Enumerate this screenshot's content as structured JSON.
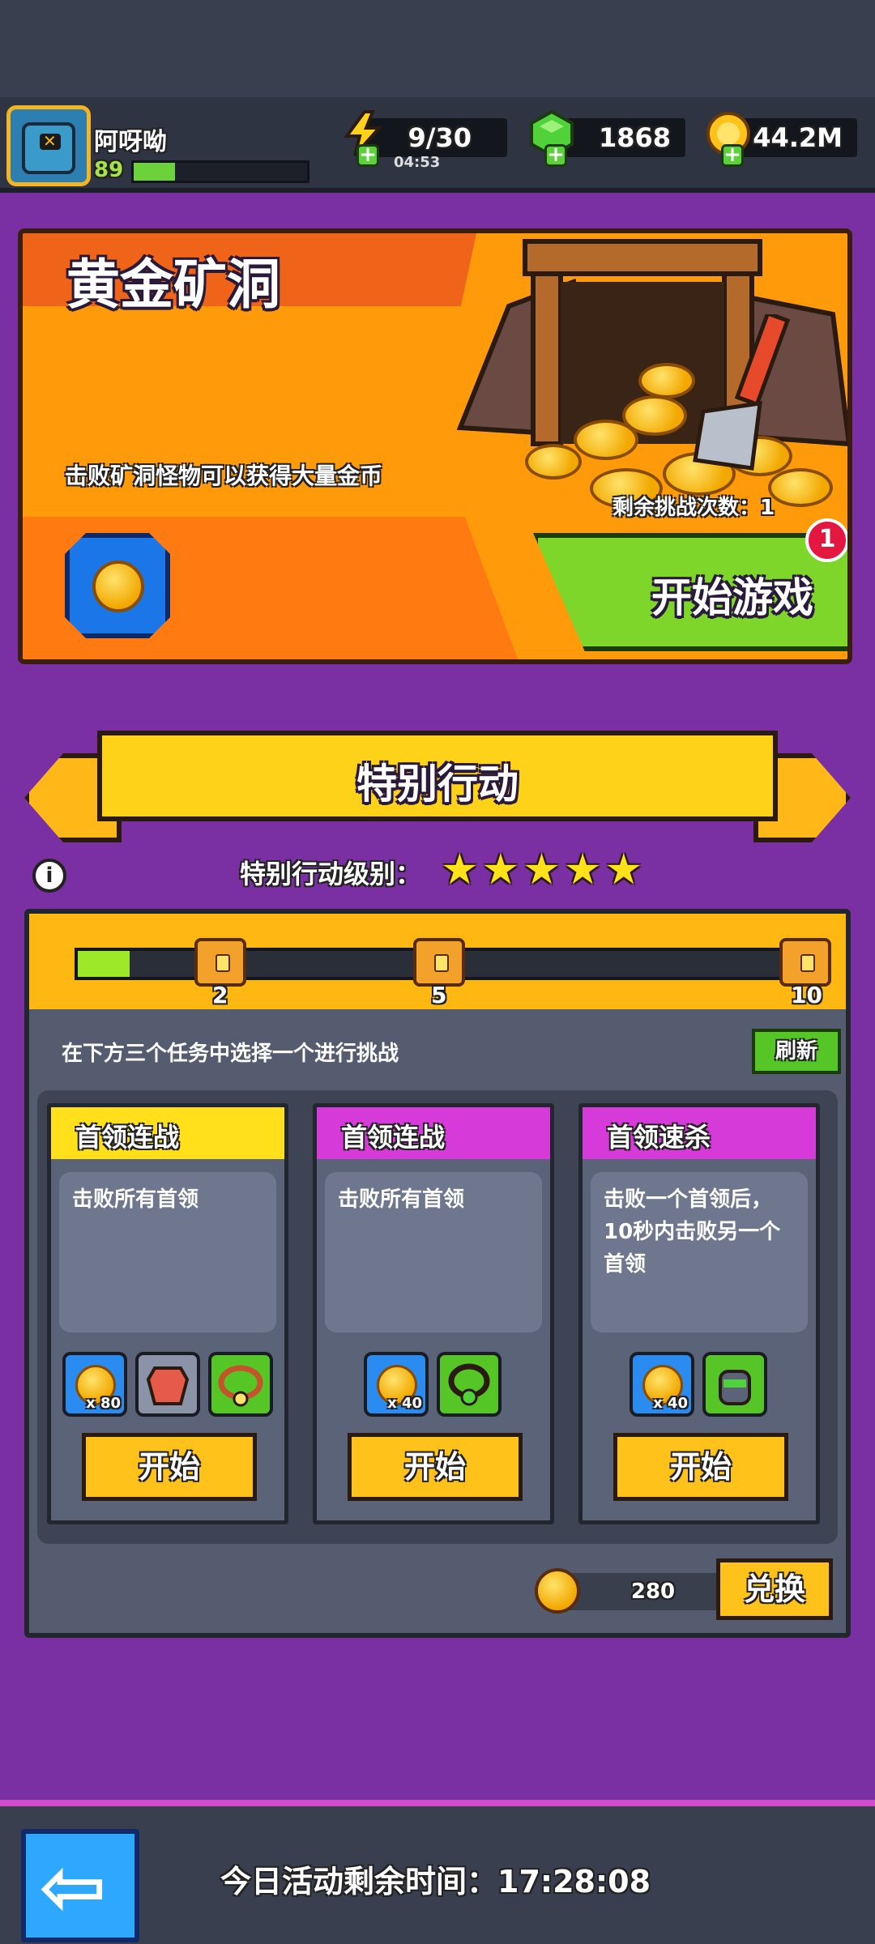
{
  "player": {
    "name": "阿呀呦",
    "level": "89",
    "xp_fraction": 0.24
  },
  "resources": {
    "energy": {
      "icon": "energy-bolt-icon",
      "value": "9/30",
      "timer": "04:53"
    },
    "gems": {
      "icon": "green-gem-icon",
      "value": "1868"
    },
    "gold": {
      "icon": "gold-coin-icon",
      "value": "44.2M"
    }
  },
  "gold_mine": {
    "title": "黄金矿洞",
    "description": "击败矿洞怪物可以获得大量金币",
    "remaining": "剩余挑战次数：1",
    "start_label": "开始游戏",
    "notification_count": "1"
  },
  "special": {
    "banner": "特别行动",
    "level_label": "特别行动级别：",
    "stars": 5,
    "progress_fraction": 0.07,
    "milestones": [
      "2",
      "5",
      "10"
    ],
    "pick_label": "在下方三个任务中选择一个进行挑战",
    "refresh_label": "刷新",
    "tasks": [
      {
        "title": "首领连战",
        "desc": "击败所有首领",
        "rewards": [
          {
            "icon": "coin-reward-icon",
            "count": "x 80"
          },
          {
            "icon": "armor-reward-icon",
            "count": ""
          },
          {
            "icon": "necklace-reward-icon",
            "count": ""
          }
        ],
        "button": "开始"
      },
      {
        "title": "首领连战",
        "desc": "击败所有首领",
        "rewards": [
          {
            "icon": "coin-reward-icon",
            "count": "x 40"
          },
          {
            "icon": "necklace-reward-icon",
            "count": ""
          }
        ],
        "button": "开始"
      },
      {
        "title": "首领速杀",
        "desc": "击败一个首领后，10秒内击败另一个首领",
        "rewards": [
          {
            "icon": "coin-reward-icon",
            "count": "x 40"
          },
          {
            "icon": "glove-reward-icon",
            "count": ""
          }
        ],
        "button": "开始"
      }
    ],
    "exchange_value": "280",
    "exchange_label": "兑换"
  },
  "footer": {
    "timer": "今日活动剩余时间：17:28:08"
  }
}
